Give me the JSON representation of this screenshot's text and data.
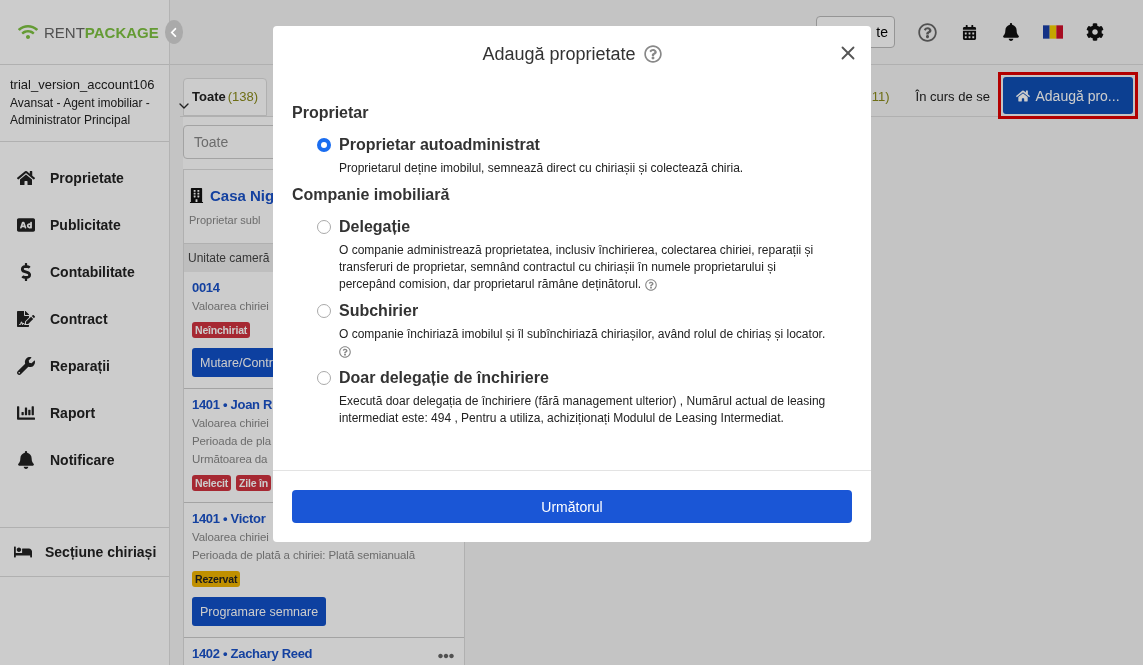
{
  "sidebar": {
    "logo": {
      "part_1": "RENT",
      "part_2": "PACKAGE"
    },
    "account": {
      "name": "trial_version_account106",
      "role": "Avansat - Agent imobiliar - Administrator Principal"
    },
    "nav_items": [
      "Proprietate",
      "Publicitate",
      "Contabilitate",
      "Contract",
      "Reparații",
      "Raport",
      "Notificare"
    ],
    "tenant_section": "Secțiune chiriași"
  },
  "header": {
    "button": "te"
  },
  "tabs": [
    {
      "label": "Toate",
      "count": "(138)",
      "selected": true
    },
    {
      "count": "11)",
      "selected": false
    },
    {
      "label": "În curs de se",
      "selected": false
    }
  ],
  "add_button": {
    "label": "Adaugă pro...",
    "highlighted": true
  },
  "search": {
    "placeholder": "Toate"
  },
  "property_card": {
    "title": "Casa Nig",
    "subtitle": "Proprietar subl",
    "column_header": "Unitate cameră"
  },
  "units": [
    {
      "title": "0014",
      "lines": [
        "Valoarea chiriei"
      ],
      "badges": [
        {
          "label": "Neînchiriat",
          "kind": "danger"
        }
      ],
      "action": "Mutare/Contr",
      "more": false
    },
    {
      "title": "1401 • Joan R",
      "lines": [
        "Valoarea chiriei",
        "Perioada de pla",
        "Următoarea da"
      ],
      "badges": [
        {
          "label": "Nelecit",
          "kind": "danger"
        },
        {
          "label": "Zile în",
          "kind": "danger"
        }
      ],
      "more": false
    },
    {
      "title": "1401 • Victor",
      "lines": [
        "Valoarea chiriei",
        "Perioada de plată a chiriei: Plată semianuală"
      ],
      "badges": [
        {
          "label": "Rezervat",
          "kind": "warning"
        }
      ],
      "action": "Programare semnare",
      "more": false
    },
    {
      "title": "1402 • Zachary Reed",
      "more": true
    }
  ],
  "modal": {
    "title": "Adaugă proprietate",
    "groups": [
      {
        "heading": "Proprietar",
        "options": [
          {
            "label": "Proprietar autoadministrat",
            "description": "Proprietarul deține imobilul, semnează direct cu chiriașii și colectează chiria.",
            "selected": true,
            "help": false
          }
        ]
      },
      {
        "heading": "Companie imobiliară",
        "options": [
          {
            "label": "Delegație",
            "description": "O companie administrează proprietatea, inclusiv închirierea, colectarea chiriei, reparații și transferuri de proprietar, semnând contractul cu chiriașii în numele proprietarului și percepând comision, dar proprietarul rămâne deținătorul.",
            "selected": false,
            "help": true
          },
          {
            "label": "Subchirier",
            "description": "O companie închiriază imobilul și îl subînchiriază chiriașilor, având rolul de chiriaș și locator.",
            "selected": false,
            "help": true
          },
          {
            "label": "Doar delegație de închiriere",
            "description": "Execută doar delegația de închiriere (fără management ulterior) , Numărul actual de leasing intermediat este: 494 , Pentru a utiliza, achiziționați Modulul de Leasing Intermediat.",
            "selected": false,
            "help": false
          }
        ]
      }
    ],
    "next_button": "Următorul"
  }
}
